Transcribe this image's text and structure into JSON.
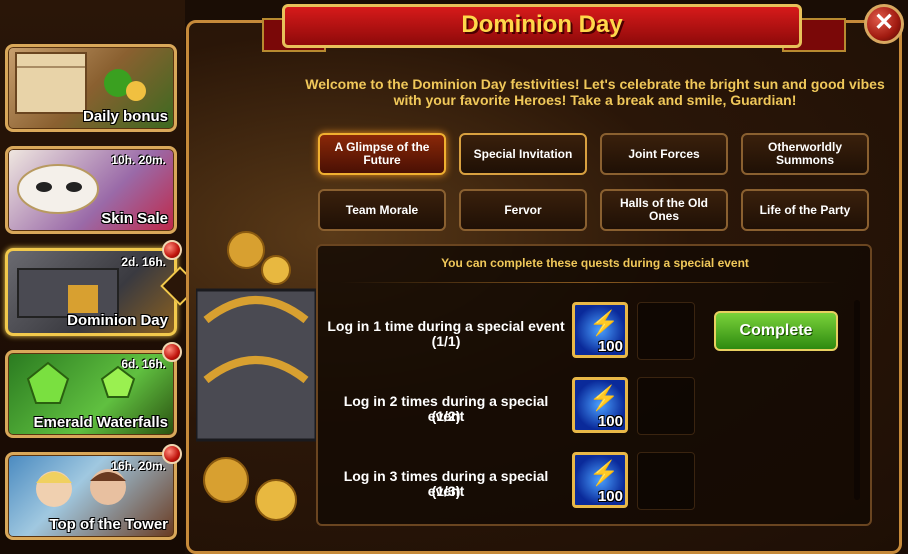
{
  "sidebar": {
    "items": [
      {
        "label": "Daily bonus",
        "timer": "",
        "badge": false
      },
      {
        "label": "Skin Sale",
        "timer": "10h. 20m.",
        "badge": false
      },
      {
        "label": "Dominion Day",
        "timer": "2d. 16h.",
        "badge": true
      },
      {
        "label": "Emerald Waterfalls",
        "timer": "6d. 16h.",
        "badge": true
      },
      {
        "label": "Top of the Tower",
        "timer": "16h. 20m.",
        "badge": true
      }
    ]
  },
  "header": {
    "title": "Dominion Day",
    "close_icon": "close-icon"
  },
  "welcome": "Welcome to the Dominion Day festivities! Let's celebrate the bright sun and good vibes with your favorite Heroes! Take a break and smile, Guardian!",
  "tabs": [
    {
      "label": "A Glimpse of the Future"
    },
    {
      "label": "Special Invitation"
    },
    {
      "label": "Joint Forces"
    },
    {
      "label": "Otherworldly Summons"
    },
    {
      "label": "Team Morale"
    },
    {
      "label": "Fervor"
    },
    {
      "label": "Halls of the Old Ones"
    },
    {
      "label": "Life of the Party"
    }
  ],
  "quests": {
    "header": "You can complete these quests during a special event",
    "items": [
      {
        "line1": "Log in 1 time during a special event",
        "progress": "(1/1)",
        "reward_qty": "100",
        "reward_icon": "energy-bolt-icon"
      },
      {
        "line1": "Log in 2 times during a special event",
        "progress": "(1/2)",
        "reward_qty": "100",
        "reward_icon": "energy-bolt-icon"
      },
      {
        "line1": "Log in 3 times during a special event",
        "progress": "(1/3)",
        "reward_qty": "100",
        "reward_icon": "energy-bolt-icon"
      }
    ],
    "complete_label": "Complete"
  },
  "colors": {
    "accent_gold": "#f0c85a",
    "banner_red": "#c0140c",
    "complete_green": "#4aae20"
  }
}
